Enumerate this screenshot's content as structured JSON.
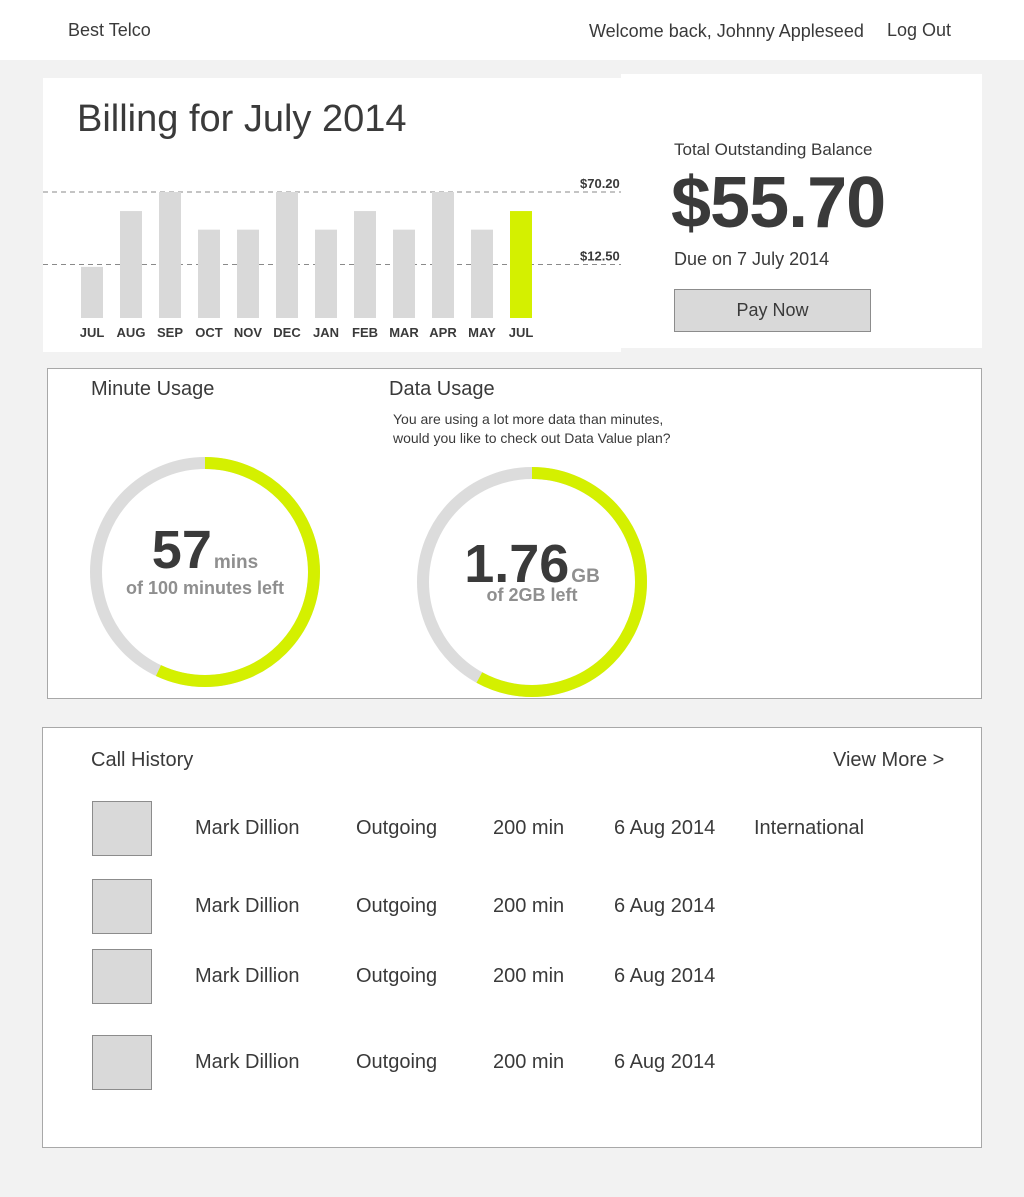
{
  "header": {
    "brand": "Best Telco",
    "welcome": "Welcome back, Johnny Appleseed",
    "logout": "Log Out"
  },
  "billing": {
    "title": "Billing for July 2014",
    "balance_label": "Total Outstanding Balance",
    "balance_amount": "$55.70",
    "due_date": "Due on 7 July 2014",
    "pay_button": "Pay Now"
  },
  "chart_data": {
    "type": "bar",
    "categories": [
      "JUL",
      "AUG",
      "SEP",
      "OCT",
      "NOV",
      "DEC",
      "JAN",
      "FEB",
      "MAR",
      "APR",
      "MAY",
      "JUL"
    ],
    "values": [
      38,
      62,
      70.2,
      54,
      54,
      70.2,
      54,
      62,
      54,
      70.2,
      54,
      62
    ],
    "reference_lines": [
      {
        "label": "$70.20",
        "value": 70.2
      },
      {
        "label": "$12.50",
        "value": 39
      }
    ],
    "ylim": [
      16,
      70.2
    ],
    "bar_color": "#d9d9d9",
    "highlight_color": "#d4f000",
    "highlight_index": 11,
    "grid": false
  },
  "minutes": {
    "title": "Minute Usage",
    "value": "57",
    "unit": "mins",
    "sub": "of 100 minutes left",
    "fraction": 0.57
  },
  "data_usage": {
    "title": "Data Usage",
    "note_line1": "You are using a lot more data than minutes,",
    "note_line2": "would you like to check out Data Value plan?",
    "value": "1.76",
    "unit": "GB",
    "sub": "of 2GB left",
    "fraction": 0.58
  },
  "colors": {
    "accent": "#d4f000",
    "ring_track": "#dcdcdc"
  },
  "call_history": {
    "title": "Call History",
    "view_more": "View More >",
    "rows": [
      {
        "name": "Mark Dillion",
        "direction": "Outgoing",
        "duration": "200 min",
        "date": "6 Aug 2014",
        "type": "International"
      },
      {
        "name": "Mark Dillion",
        "direction": "Outgoing",
        "duration": "200 min",
        "date": "6 Aug 2014",
        "type": ""
      },
      {
        "name": "Mark Dillion",
        "direction": "Outgoing",
        "duration": "200 min",
        "date": "6 Aug 2014",
        "type": ""
      },
      {
        "name": "Mark Dillion",
        "direction": "Outgoing",
        "duration": "200 min",
        "date": "6 Aug 2014",
        "type": ""
      }
    ]
  }
}
